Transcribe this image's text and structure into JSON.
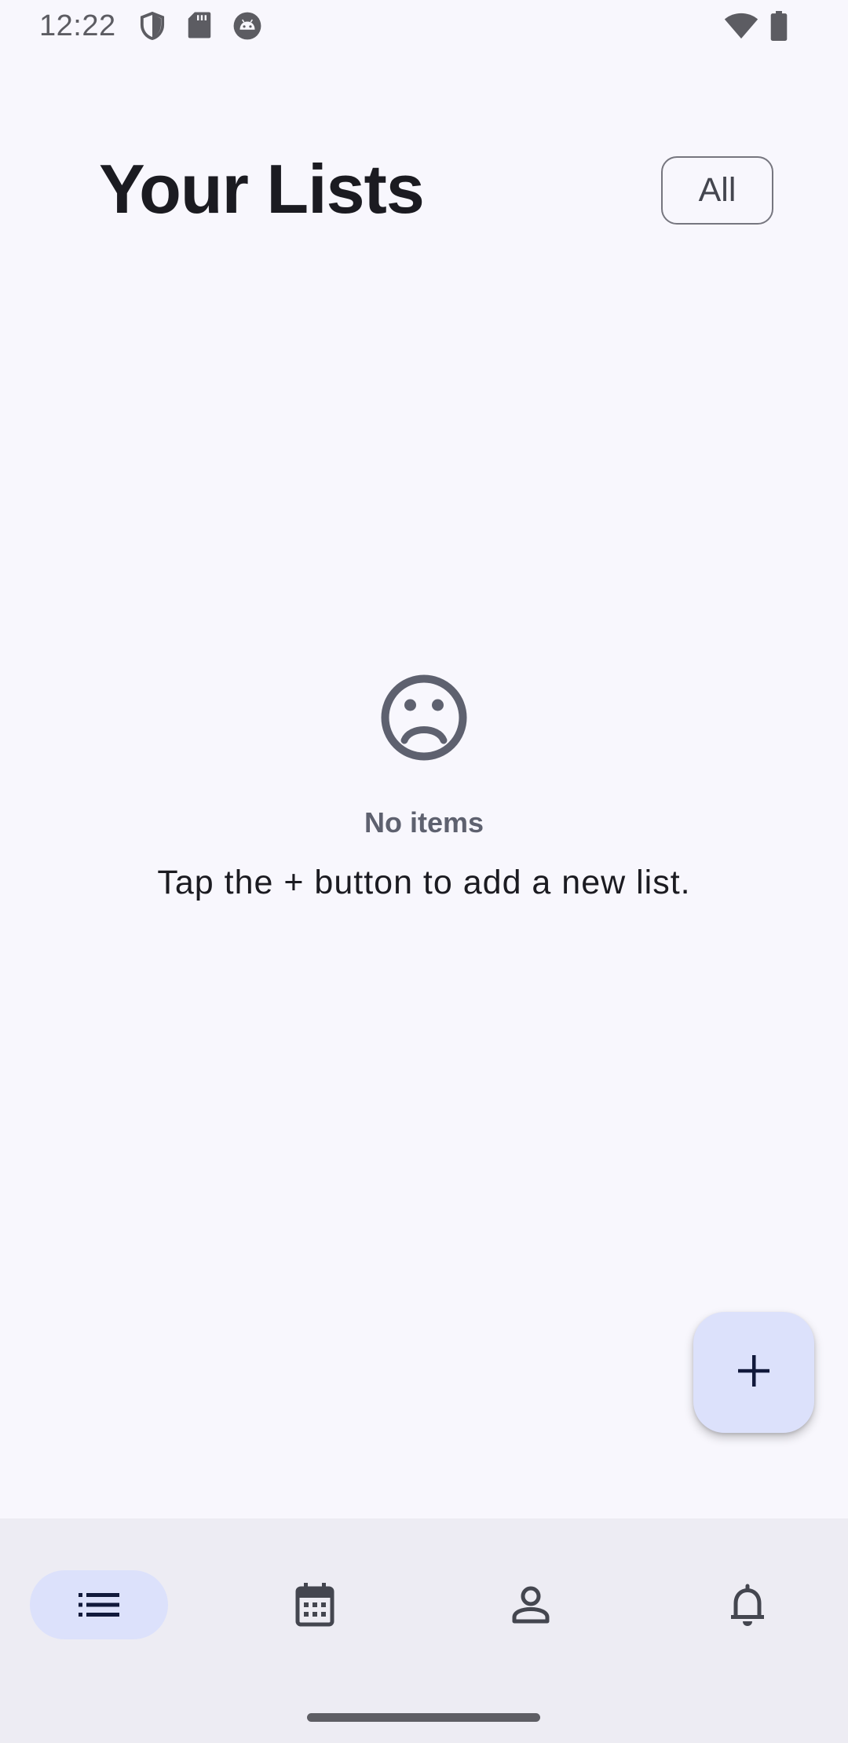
{
  "status_bar": {
    "time": "12:22",
    "icons": [
      "shield-icon",
      "sd-card-icon",
      "android-icon",
      "wifi-icon",
      "battery-icon"
    ]
  },
  "header": {
    "title": "Your Lists",
    "filter_label": "All"
  },
  "empty_state": {
    "icon": "sad-face-icon",
    "title": "No items",
    "message": "Tap the + button to add a new list."
  },
  "fab": {
    "icon": "plus-icon"
  },
  "bottom_nav": {
    "items": [
      {
        "icon": "list-icon",
        "active": true
      },
      {
        "icon": "calendar-icon",
        "active": false
      },
      {
        "icon": "person-icon",
        "active": false
      },
      {
        "icon": "bell-icon",
        "active": false
      }
    ]
  },
  "colors": {
    "background": "#f8f7fd",
    "accent_container": "#dce1fb",
    "nav_background": "#edecf3",
    "on_surface": "#1b1b21",
    "icon_gray": "#5e616f"
  }
}
